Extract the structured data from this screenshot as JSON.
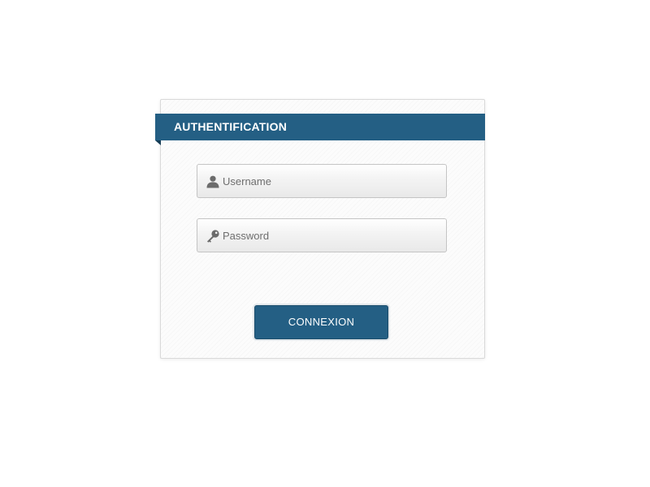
{
  "panel": {
    "title": "AUTHENTIFICATION"
  },
  "form": {
    "username": {
      "placeholder": "Username",
      "value": "",
      "icon": "user-icon"
    },
    "password": {
      "placeholder": "Password",
      "value": "",
      "icon": "key-icon"
    },
    "submit_label": "CONNEXION"
  },
  "colors": {
    "accent": "#245f84",
    "icon": "#6b6b6b"
  }
}
